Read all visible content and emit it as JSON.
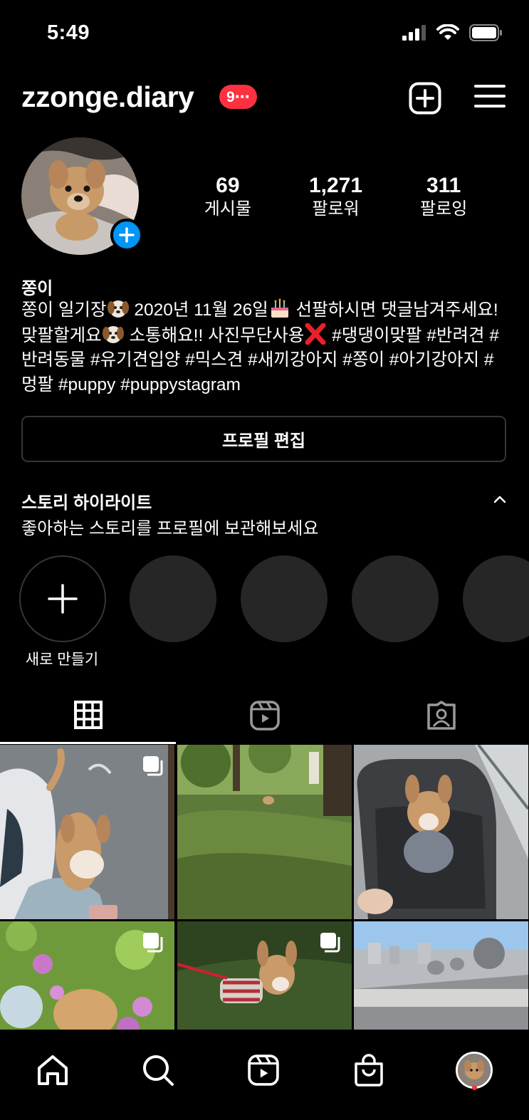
{
  "status_bar": {
    "time": "5:49"
  },
  "header": {
    "username": "zzonge.diary",
    "notification_badge": "9⋯"
  },
  "profile": {
    "stats": [
      {
        "value": "69",
        "label": "게시물"
      },
      {
        "value": "1,271",
        "label": "팔로워"
      },
      {
        "value": "311",
        "label": "팔로잉"
      }
    ],
    "display_name": "쫑이",
    "bio": {
      "p1": "쫑이 일기장",
      "p2": " 2020년 11월 26일",
      "p3": " 선팔하시면 댓글남겨주세요! 맞팔할게요",
      "p4": " 소통해요!! 사진무단사용",
      "p5": " #댕댕이맞팔 #반려견 #반려동물 #유기견입양 #믹스견 #새끼강아지 #쫑이 #아기강아지 #멍팔 #puppy #puppystagram"
    },
    "edit_button": "프로필 편집"
  },
  "highlights": {
    "title": "스토리 하이라이트",
    "subtitle": "좋아하는 스토리를 프로필에 보관해보세요",
    "new_label": "새로 만들기"
  },
  "tabs": [
    {
      "icon": "grid-icon",
      "active": true
    },
    {
      "icon": "reels-icon",
      "active": false
    },
    {
      "icon": "tagged-icon",
      "active": false
    }
  ],
  "posts": [
    {
      "content": "dog-on-blanket-photo",
      "multi": true
    },
    {
      "content": "dog-in-grass-park-photo",
      "multi": false
    },
    {
      "content": "dog-in-stroller-photo",
      "multi": false
    },
    {
      "content": "dog-in-flowers-photo",
      "multi": true
    },
    {
      "content": "dog-in-striped-shirt-photo",
      "multi": true
    },
    {
      "content": "rooftop-ventilators-photo",
      "multi": false
    }
  ],
  "bottom_nav": [
    "home-icon",
    "search-icon",
    "reels-icon",
    "shop-icon",
    "profile-avatar"
  ],
  "colors": {
    "accent": "#0095f6",
    "badge": "#ff3040",
    "background": "#000000"
  }
}
